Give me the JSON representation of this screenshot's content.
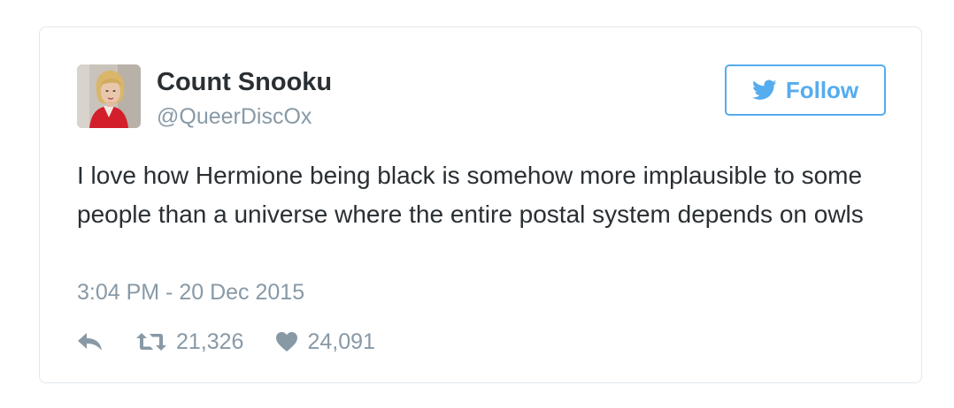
{
  "tweet": {
    "display_name": "Count Snooku",
    "handle": "@QueerDiscOx",
    "follow_label": "Follow",
    "text": "I love how Hermione being black is somehow more implausible to some people than a universe where the entire postal system depends on owls",
    "timestamp": "3:04 PM - 20 Dec 2015",
    "retweet_count": "21,326",
    "like_count": "24,091"
  },
  "icons": {
    "avatar": "profile-photo",
    "follow": "twitter-bird-icon",
    "reply": "reply-arrow-icon",
    "retweet": "retweet-icon",
    "like": "heart-icon"
  },
  "colors": {
    "accent": "#55acee",
    "text_primary": "#292f33",
    "text_secondary": "#8899a6",
    "border": "#e1e8ed"
  }
}
